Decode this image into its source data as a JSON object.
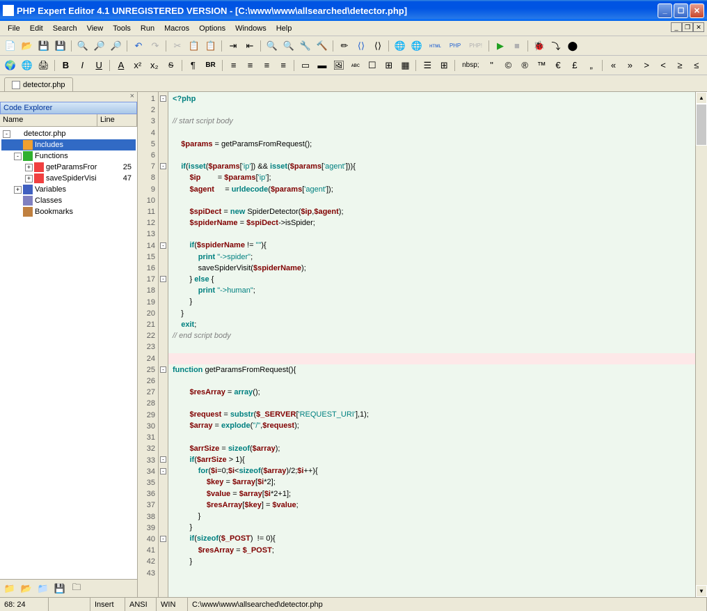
{
  "window": {
    "title": "PHP Expert Editor 4.1 UNREGISTERED VERSION - [C:\\www\\www\\allsearched\\detector.php]"
  },
  "menu": [
    "File",
    "Edit",
    "Search",
    "View",
    "Tools",
    "Run",
    "Macros",
    "Options",
    "Windows",
    "Help"
  ],
  "tab": {
    "label": "detector.php"
  },
  "sidebar": {
    "title": "Code Explorer",
    "columns": {
      "name": "Name",
      "line": "Line"
    },
    "nodes": [
      {
        "indent": 0,
        "exp": "-",
        "icon": "#fff",
        "label": "detector.php",
        "line": ""
      },
      {
        "indent": 1,
        "exp": "",
        "icon": "#f0a030",
        "label": "Includes",
        "line": "",
        "sel": true
      },
      {
        "indent": 1,
        "exp": "-",
        "icon": "#30b030",
        "label": "Functions",
        "line": ""
      },
      {
        "indent": 2,
        "exp": "+",
        "icon": "#f04040",
        "label": "getParamsFror",
        "line": "25"
      },
      {
        "indent": 2,
        "exp": "+",
        "icon": "#f04040",
        "label": "saveSpiderVisi",
        "line": "47"
      },
      {
        "indent": 1,
        "exp": "+",
        "icon": "#4060c0",
        "label": "Variables",
        "line": ""
      },
      {
        "indent": 1,
        "exp": "",
        "icon": "#8080c0",
        "label": "Classes",
        "line": ""
      },
      {
        "indent": 1,
        "exp": "",
        "icon": "#c08040",
        "label": "Bookmarks",
        "line": ""
      }
    ]
  },
  "tb2": {
    "nbsp": "nbsp;"
  },
  "code": {
    "lines": 43,
    "highlight": 24,
    "tokens": [
      [
        [
          "kw",
          "<?php"
        ]
      ],
      [],
      [
        [
          "cm",
          "// start script body"
        ]
      ],
      [],
      [
        [
          "pl",
          "    "
        ],
        [
          "var",
          "$params"
        ],
        [
          "pl",
          " = getParamsFromRequest();"
        ]
      ],
      [],
      [
        [
          "pl",
          "    "
        ],
        [
          "kw",
          "if"
        ],
        [
          "pl",
          "("
        ],
        [
          "kw",
          "isset"
        ],
        [
          "pl",
          "("
        ],
        [
          "var",
          "$params"
        ],
        [
          "pl",
          "["
        ],
        [
          "str",
          "'ip'"
        ],
        [
          "pl",
          "]) && "
        ],
        [
          "kw",
          "isset"
        ],
        [
          "pl",
          "("
        ],
        [
          "var",
          "$params"
        ],
        [
          "pl",
          "["
        ],
        [
          "str",
          "'agent'"
        ],
        [
          "pl",
          "])){"
        ]
      ],
      [
        [
          "pl",
          "        "
        ],
        [
          "var",
          "$ip"
        ],
        [
          "pl",
          "        = "
        ],
        [
          "var",
          "$params"
        ],
        [
          "pl",
          "["
        ],
        [
          "str",
          "'ip'"
        ],
        [
          "pl",
          "];"
        ]
      ],
      [
        [
          "pl",
          "        "
        ],
        [
          "var",
          "$agent"
        ],
        [
          "pl",
          "     = "
        ],
        [
          "kw",
          "urldecode"
        ],
        [
          "pl",
          "("
        ],
        [
          "var",
          "$params"
        ],
        [
          "pl",
          "["
        ],
        [
          "str",
          "'agent'"
        ],
        [
          "pl",
          "]);"
        ]
      ],
      [],
      [
        [
          "pl",
          "        "
        ],
        [
          "var",
          "$spiDect"
        ],
        [
          "pl",
          " = "
        ],
        [
          "kw",
          "new"
        ],
        [
          "pl",
          " SpiderDetector("
        ],
        [
          "var",
          "$ip"
        ],
        [
          "pl",
          ","
        ],
        [
          "var",
          "$agent"
        ],
        [
          "pl",
          ");"
        ]
      ],
      [
        [
          "pl",
          "        "
        ],
        [
          "var",
          "$spiderName"
        ],
        [
          "pl",
          " = "
        ],
        [
          "var",
          "$spiDect"
        ],
        [
          "pl",
          "->isSpider;"
        ]
      ],
      [],
      [
        [
          "pl",
          "        "
        ],
        [
          "kw",
          "if"
        ],
        [
          "pl",
          "("
        ],
        [
          "var",
          "$spiderName"
        ],
        [
          "pl",
          " != "
        ],
        [
          "str",
          "\"\""
        ],
        [
          "pl",
          "){"
        ]
      ],
      [
        [
          "pl",
          "            "
        ],
        [
          "kw",
          "print"
        ],
        [
          "pl",
          " "
        ],
        [
          "str",
          "\"->spider\""
        ],
        [
          "pl",
          ";"
        ]
      ],
      [
        [
          "pl",
          "            saveSpiderVisit("
        ],
        [
          "var",
          "$spiderName"
        ],
        [
          "pl",
          ");"
        ]
      ],
      [
        [
          "pl",
          "        } "
        ],
        [
          "kw",
          "else"
        ],
        [
          "pl",
          " {"
        ]
      ],
      [
        [
          "pl",
          "            "
        ],
        [
          "kw",
          "print"
        ],
        [
          "pl",
          " "
        ],
        [
          "str",
          "\"->human\""
        ],
        [
          "pl",
          ";"
        ]
      ],
      [
        [
          "pl",
          "        }"
        ]
      ],
      [
        [
          "pl",
          "    }"
        ]
      ],
      [
        [
          "pl",
          "    "
        ],
        [
          "kw",
          "exit"
        ],
        [
          "pl",
          ";"
        ]
      ],
      [
        [
          "cm",
          "// end script body"
        ]
      ],
      [],
      [],
      [
        [
          "kw",
          "function"
        ],
        [
          "pl",
          " getParamsFromRequest(){"
        ]
      ],
      [],
      [
        [
          "pl",
          "        "
        ],
        [
          "var",
          "$resArray"
        ],
        [
          "pl",
          " = "
        ],
        [
          "kw",
          "array"
        ],
        [
          "pl",
          "();"
        ]
      ],
      [],
      [
        [
          "pl",
          "        "
        ],
        [
          "var",
          "$request"
        ],
        [
          "pl",
          " = "
        ],
        [
          "kw",
          "substr"
        ],
        [
          "pl",
          "("
        ],
        [
          "var",
          "$_SERVER"
        ],
        [
          "pl",
          "["
        ],
        [
          "str",
          "'REQUEST_URI'"
        ],
        [
          "pl",
          "],1);"
        ]
      ],
      [
        [
          "pl",
          "        "
        ],
        [
          "var",
          "$array"
        ],
        [
          "pl",
          " = "
        ],
        [
          "kw",
          "explode"
        ],
        [
          "pl",
          "("
        ],
        [
          "str",
          "\"/\""
        ],
        [
          "pl",
          ","
        ],
        [
          "var",
          "$request"
        ],
        [
          "pl",
          ");"
        ]
      ],
      [],
      [
        [
          "pl",
          "        "
        ],
        [
          "var",
          "$arrSize"
        ],
        [
          "pl",
          " = "
        ],
        [
          "kw",
          "sizeof"
        ],
        [
          "pl",
          "("
        ],
        [
          "var",
          "$array"
        ],
        [
          "pl",
          ");"
        ]
      ],
      [
        [
          "pl",
          "        "
        ],
        [
          "kw",
          "if"
        ],
        [
          "pl",
          "("
        ],
        [
          "var",
          "$arrSize"
        ],
        [
          "pl",
          " > 1){"
        ]
      ],
      [
        [
          "pl",
          "            "
        ],
        [
          "kw",
          "for"
        ],
        [
          "pl",
          "("
        ],
        [
          "var",
          "$i"
        ],
        [
          "pl",
          "=0;"
        ],
        [
          "var",
          "$i"
        ],
        [
          "pl",
          "<"
        ],
        [
          "kw",
          "sizeof"
        ],
        [
          "pl",
          "("
        ],
        [
          "var",
          "$array"
        ],
        [
          "pl",
          ")/2;"
        ],
        [
          "var",
          "$i"
        ],
        [
          "pl",
          "++){"
        ]
      ],
      [
        [
          "pl",
          "                "
        ],
        [
          "var",
          "$key"
        ],
        [
          "pl",
          " = "
        ],
        [
          "var",
          "$array"
        ],
        [
          "pl",
          "["
        ],
        [
          "var",
          "$i"
        ],
        [
          "pl",
          "*2];"
        ]
      ],
      [
        [
          "pl",
          "                "
        ],
        [
          "var",
          "$value"
        ],
        [
          "pl",
          " = "
        ],
        [
          "var",
          "$array"
        ],
        [
          "pl",
          "["
        ],
        [
          "var",
          "$i"
        ],
        [
          "pl",
          "*2+1];"
        ]
      ],
      [
        [
          "pl",
          "                "
        ],
        [
          "var",
          "$resArray"
        ],
        [
          "pl",
          "["
        ],
        [
          "var",
          "$key"
        ],
        [
          "pl",
          "] = "
        ],
        [
          "var",
          "$value"
        ],
        [
          "pl",
          ";"
        ]
      ],
      [
        [
          "pl",
          "            }"
        ]
      ],
      [
        [
          "pl",
          "        }"
        ]
      ],
      [
        [
          "pl",
          "        "
        ],
        [
          "kw",
          "if"
        ],
        [
          "pl",
          "("
        ],
        [
          "kw",
          "sizeof"
        ],
        [
          "pl",
          "("
        ],
        [
          "var",
          "$_POST"
        ],
        [
          "pl",
          ")  != 0){"
        ]
      ],
      [
        [
          "pl",
          "            "
        ],
        [
          "var",
          "$resArray"
        ],
        [
          "pl",
          " = "
        ],
        [
          "var",
          "$_POST"
        ],
        [
          "pl",
          ";"
        ]
      ],
      [
        [
          "pl",
          "        }"
        ]
      ],
      []
    ],
    "folds": [
      {
        "line": 1,
        "sym": "-"
      },
      {
        "line": 7,
        "sym": "-"
      },
      {
        "line": 14,
        "sym": "-"
      },
      {
        "line": 17,
        "sym": "-"
      },
      {
        "line": 25,
        "sym": "-"
      },
      {
        "line": 33,
        "sym": "-"
      },
      {
        "line": 34,
        "sym": "-"
      },
      {
        "line": 40,
        "sym": "-"
      }
    ]
  },
  "status": {
    "pos": "68: 24",
    "insert": "Insert",
    "enc": "ANSI",
    "os": "WIN",
    "path": "C:\\www\\www\\allsearched\\detector.php"
  }
}
